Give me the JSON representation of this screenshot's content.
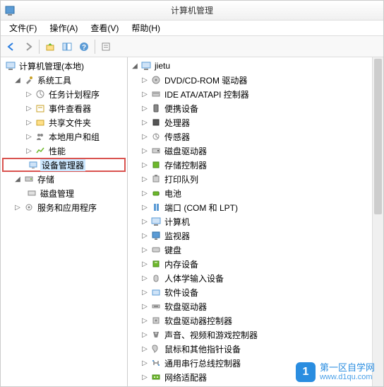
{
  "title": "计算机管理",
  "menu": {
    "file": "文件(F)",
    "action": "操作(A)",
    "view": "查看(V)",
    "help": "帮助(H)"
  },
  "left_tree": {
    "root": "计算机管理(本地)",
    "system_tools": "系统工具",
    "task_scheduler": "任务计划程序",
    "event_viewer": "事件查看器",
    "shared_folders": "共享文件夹",
    "local_users": "本地用户和组",
    "performance": "性能",
    "device_manager": "设备管理器",
    "storage": "存储",
    "disk_mgmt": "磁盘管理",
    "services_apps": "服务和应用程序"
  },
  "right_tree": {
    "root": "jietu",
    "items": [
      "DVD/CD-ROM 驱动器",
      "IDE ATA/ATAPI 控制器",
      "便携设备",
      "处理器",
      "传感器",
      "磁盘驱动器",
      "存储控制器",
      "打印队列",
      "电池",
      "端口 (COM 和 LPT)",
      "计算机",
      "监视器",
      "键盘",
      "内存设备",
      "人体学输入设备",
      "软件设备",
      "软盘驱动器",
      "软盘驱动器控制器",
      "声音、视频和游戏控制器",
      "鼠标和其他指针设备",
      "通用串行总线控制器",
      "网络适配器"
    ]
  },
  "watermark": {
    "name": "第一区自学网",
    "url": "www.d1qu.com",
    "badge": "1"
  }
}
